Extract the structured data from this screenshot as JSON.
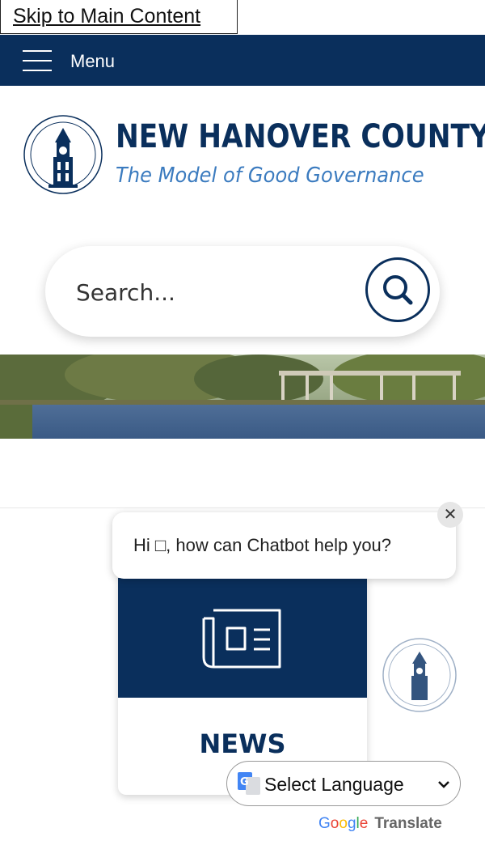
{
  "skip_link": "Skip to Main Content",
  "header": {
    "menu_label": "Menu"
  },
  "brand": {
    "name": "NEW HANOVER COUNTY",
    "tagline": "The Model of Good Governance"
  },
  "search": {
    "placeholder": "Search..."
  },
  "chatbot": {
    "message": "Hi □, how can Chatbot help you?",
    "close": "✕"
  },
  "quick_links": [
    {
      "label": "NEWS",
      "icon": "newspaper-icon"
    }
  ],
  "translate": {
    "select_label": "Select Language",
    "brand_letters": [
      "G",
      "o",
      "o",
      "g",
      "l",
      "e"
    ],
    "brand_suffix": "Translate"
  },
  "colors": {
    "navy": "#0a2f5c",
    "tagline_blue": "#3b7bbf"
  }
}
